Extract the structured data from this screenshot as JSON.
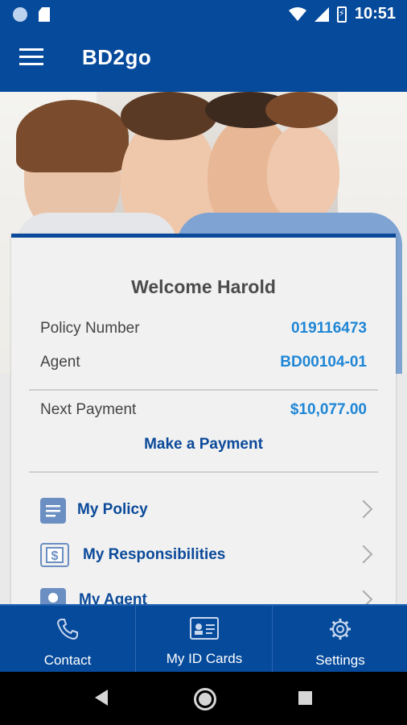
{
  "status_bar": {
    "time": "10:51"
  },
  "app_bar": {
    "title": "BD2go"
  },
  "welcome": {
    "heading": "Welcome Harold"
  },
  "policy": {
    "policy_number_label": "Policy Number",
    "policy_number_value": "019116473",
    "agent_label": "Agent",
    "agent_value": "BD00104-01",
    "next_payment_label": "Next Payment",
    "next_payment_value": "$10,077.00",
    "make_payment_label": "Make a Payment"
  },
  "menu": {
    "items": [
      {
        "label": "My Policy",
        "icon": "document-icon"
      },
      {
        "label": "My Responsibilities",
        "icon": "dollar-icon"
      },
      {
        "label": "My Agent",
        "icon": "agent-icon"
      }
    ]
  },
  "bottom_nav": {
    "tabs": [
      {
        "label": "Contact",
        "icon": "phone-icon"
      },
      {
        "label": "My ID Cards",
        "icon": "id-card-icon"
      },
      {
        "label": "Settings",
        "icon": "gear-icon"
      }
    ]
  },
  "colors": {
    "brand": "#064a9b",
    "accent": "#1e86d6",
    "card_bg": "#f1f1f1"
  }
}
